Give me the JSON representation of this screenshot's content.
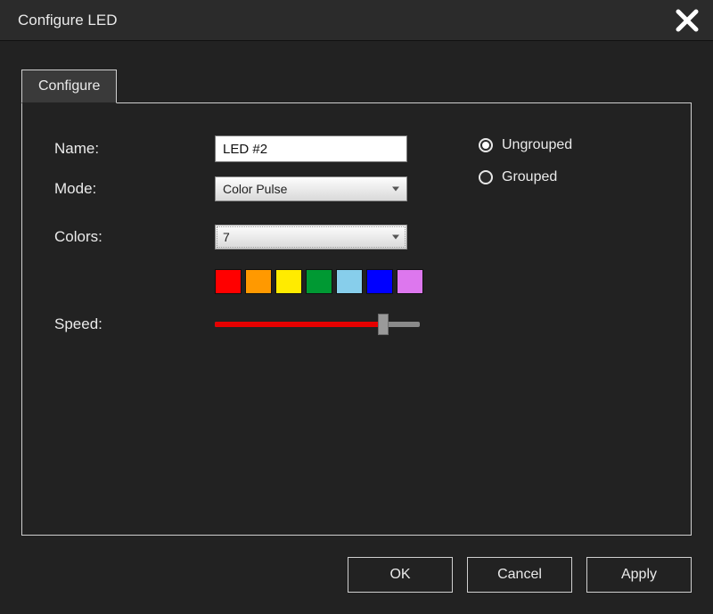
{
  "title": "Configure LED",
  "tab": {
    "label": "Configure"
  },
  "form": {
    "name_label": "Name:",
    "name_value": "LED #2",
    "mode_label": "Mode:",
    "mode_value": "Color Pulse",
    "colors_label": "Colors:",
    "colors_value": "7",
    "speed_label": "Speed:"
  },
  "grouping": {
    "ungrouped_label": "Ungrouped",
    "grouped_label": "Grouped",
    "selected": "ungrouped"
  },
  "swatches": [
    "#ff0000",
    "#ff9900",
    "#ffeb00",
    "#009933",
    "#87ceeb",
    "#0000ff",
    "#dd77ee"
  ],
  "speed": {
    "percent": 82
  },
  "buttons": {
    "ok": "OK",
    "cancel": "Cancel",
    "apply": "Apply"
  }
}
